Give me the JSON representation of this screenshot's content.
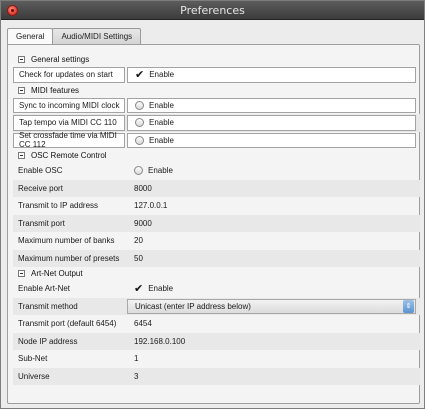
{
  "window": {
    "title": "Preferences"
  },
  "tabs": [
    {
      "label": "General"
    },
    {
      "label": "Audio/MIDI Settings"
    }
  ],
  "sections": {
    "general": {
      "title": "General settings",
      "rows": [
        {
          "label": "Check for updates on start",
          "value": "Enable"
        }
      ]
    },
    "midi": {
      "title": "MIDI features",
      "rows": [
        {
          "label": "Sync to incoming MIDI clock",
          "value": "Enable"
        },
        {
          "label": "Tap tempo via MIDI CC 110",
          "value": "Enable"
        },
        {
          "label": "Set crossfade time via MIDI CC 112",
          "value": "Enable"
        }
      ]
    },
    "osc": {
      "title": "OSC Remote Control",
      "rows": [
        {
          "label": "Enable OSC",
          "value": "Enable"
        },
        {
          "label": "Receive port",
          "value": "8000"
        },
        {
          "label": "Transmit to IP address",
          "value": "127.0.0.1"
        },
        {
          "label": "Transmit port",
          "value": "9000"
        },
        {
          "label": "Maximum number of banks",
          "value": "20"
        },
        {
          "label": "Maximum number of presets",
          "value": "50"
        }
      ]
    },
    "artnet": {
      "title": "Art-Net Output",
      "rows": [
        {
          "label": "Enable Art-Net",
          "value": "Enable"
        },
        {
          "label": "Transmit method",
          "value": "Unicast (enter IP address below)"
        },
        {
          "label": "Transmit port (default 6454)",
          "value": "6454"
        },
        {
          "label": "Node IP address",
          "value": "192.168.0.100"
        },
        {
          "label": "Sub-Net",
          "value": "1"
        },
        {
          "label": "Universe",
          "value": "3"
        }
      ]
    }
  },
  "icons": {
    "checkmark": "✔",
    "select_arrows": "⇕"
  }
}
